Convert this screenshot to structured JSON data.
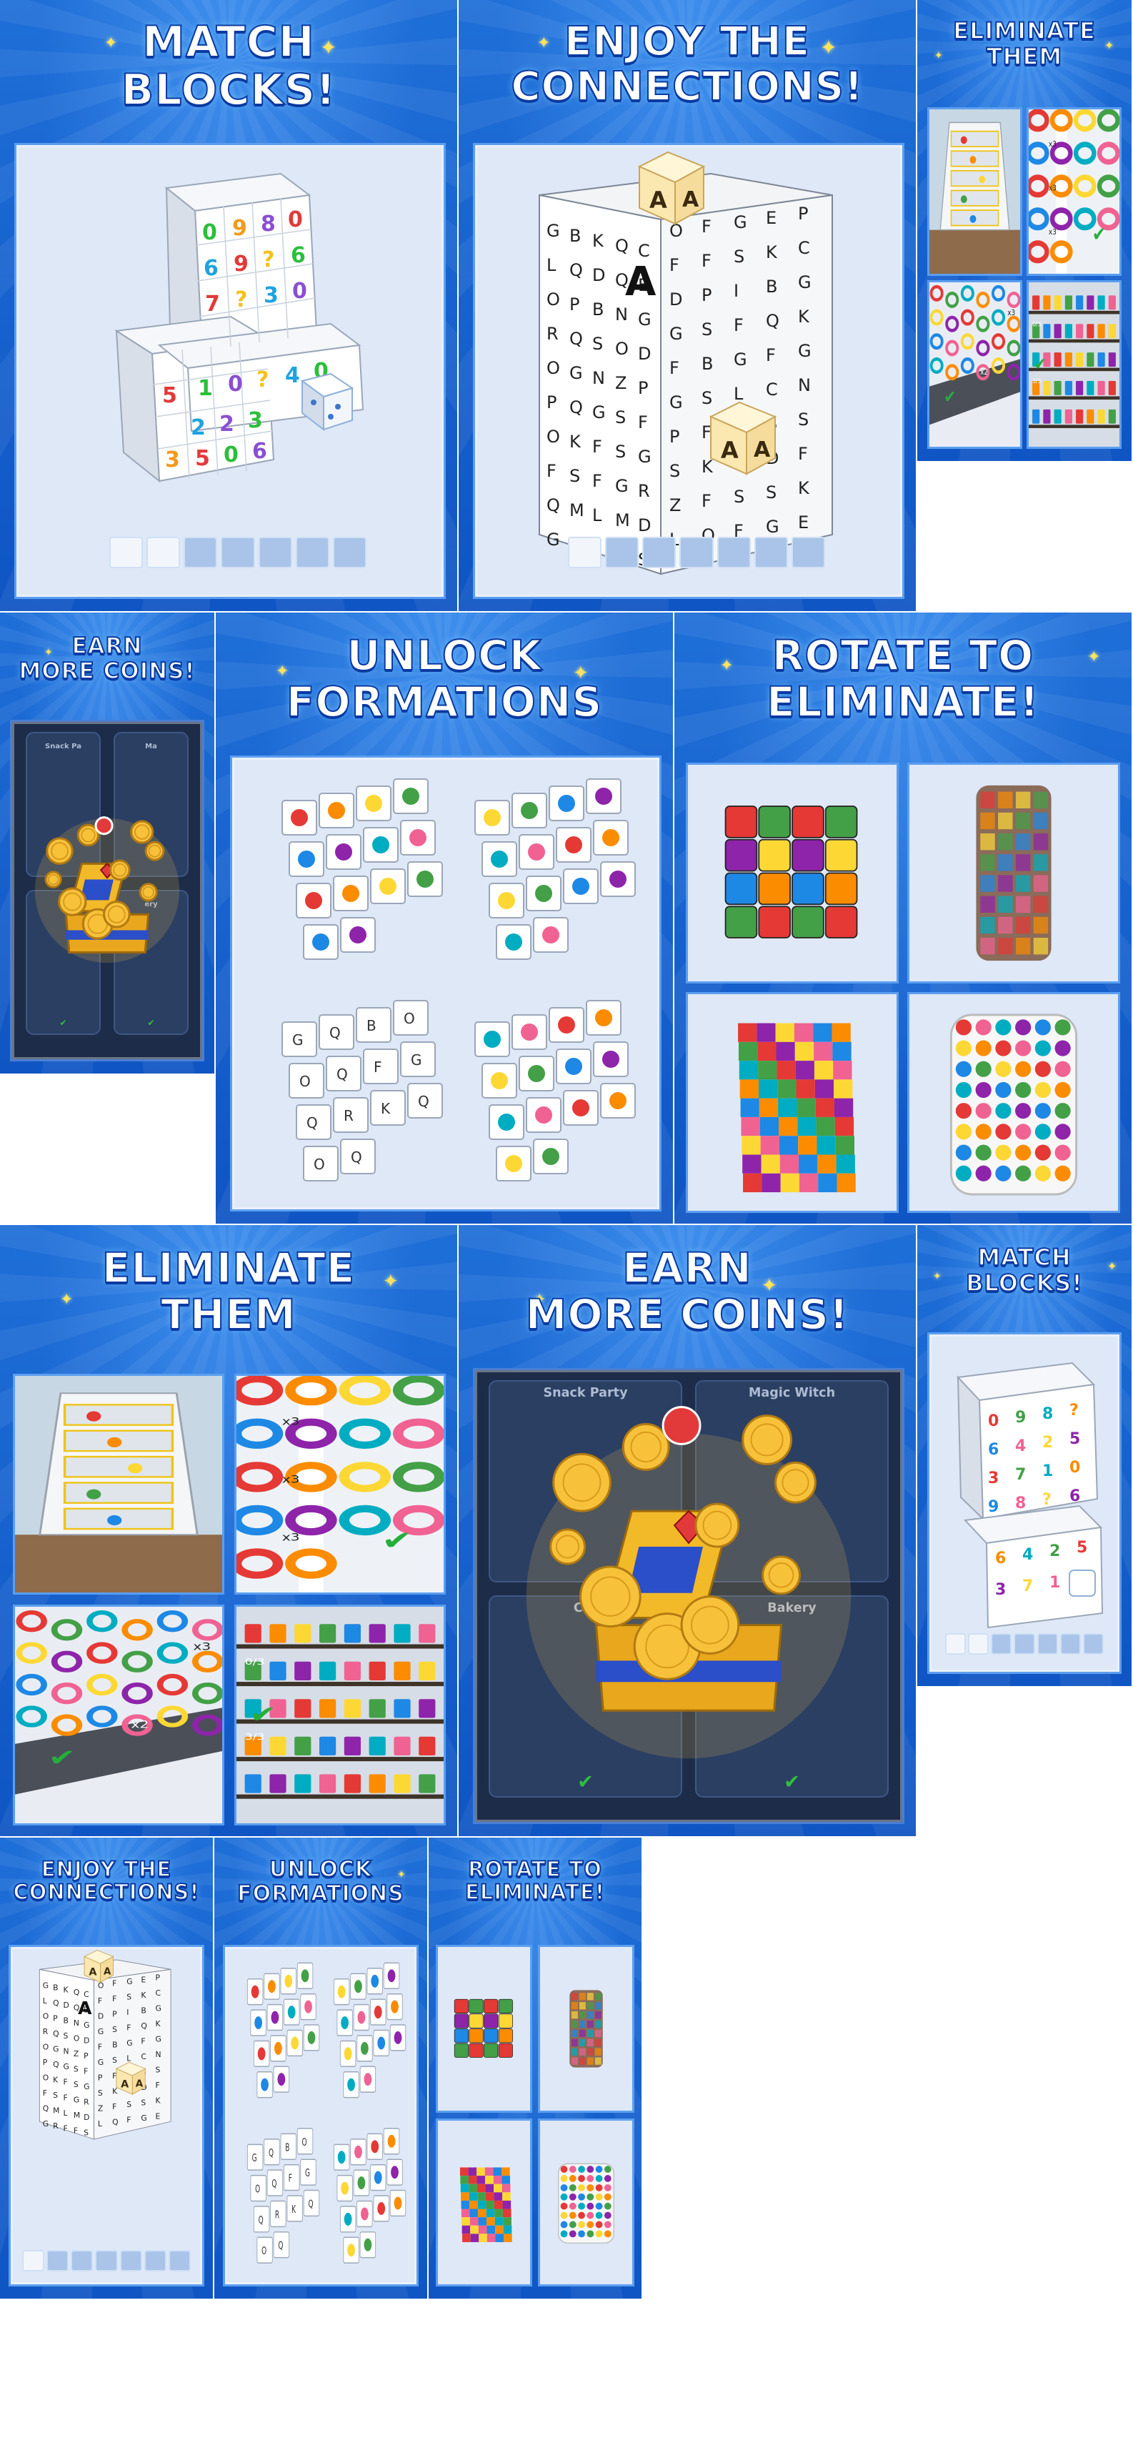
{
  "captions": {
    "match_blocks": [
      "MATCH",
      "BLOCKS!"
    ],
    "enjoy_connections": [
      "ENJOY THE",
      "CONNECTIONS!"
    ],
    "eliminate_them": [
      "ELIMINATE",
      "THEM"
    ],
    "earn_more_coins": [
      "EARN",
      "MORE COINS!"
    ],
    "unlock_formations": [
      "UNLOCK",
      "FORMATIONS"
    ],
    "rotate_to_eliminate": [
      "ROTATE TO",
      "ELIMINATE!"
    ]
  },
  "coins_screen": {
    "card_labels": [
      "Snack Party",
      "Magic Witch",
      "Cat",
      "Bakery"
    ],
    "card_short": [
      "Snack Pa",
      "Ma",
      "Ca",
      "ery"
    ],
    "check": "✔"
  },
  "eliminate_screen": {
    "multipliers": [
      "x3",
      "x3",
      "x3",
      "x2",
      "x3"
    ],
    "shelf_counts": [
      "0/3",
      "3/3"
    ]
  },
  "word_cube": {
    "rows": [
      "GBKQC",
      "LQDQE",
      "OPBNG",
      "RQSOD",
      "OGNZP",
      "PQGSF",
      "OKFSG",
      "FSFGR",
      "QMLMD",
      "GRFFS"
    ],
    "side_rows": [
      "OFGEP",
      "FFSKC",
      "DPIBG",
      "GSFQK",
      "FBGFG",
      "GSLCN",
      "PFGBS",
      "SKPDF",
      "ZFSSK",
      "LQFGE"
    ],
    "tile_letter": "A"
  },
  "number_cube": {
    "glyphs": [
      "0",
      "9",
      "8",
      "?",
      "6",
      "4",
      "2",
      "5",
      "3",
      "7",
      "1"
    ]
  },
  "colors": {
    "tile_blue": "#1464d2",
    "panel_bg": "#dfe8f6",
    "panel_border": "#5b9ef0",
    "coin_gold": "#f5b21e",
    "dark_panel": "#1d2c49"
  },
  "icons": [
    "sparkle-star-icon",
    "dice-icon",
    "gold-coin-icon",
    "treasure-chest-icon",
    "heart-infinity-icon",
    "check-icon",
    "hand-pointer-icon"
  ]
}
